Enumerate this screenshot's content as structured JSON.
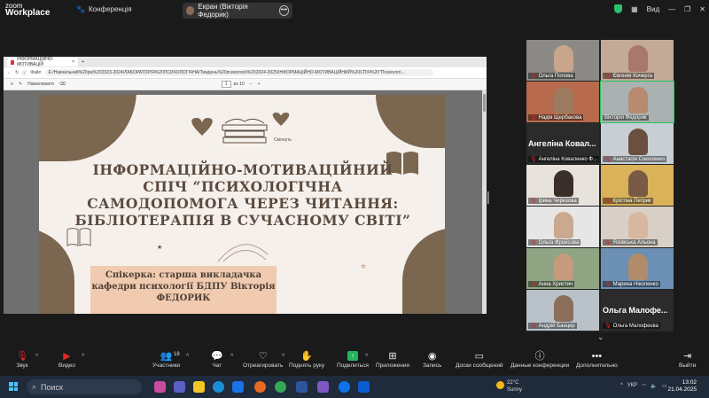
{
  "app": {
    "brand_top": "zoom",
    "brand_bottom": "Workplace",
    "conference_tab": "Конференція"
  },
  "share_pill": {
    "label": "Екран (Вікторія Федорик)"
  },
  "titlebar_right": {
    "view": "Вид"
  },
  "browser": {
    "tab_label": "ІНФОРМАЦІЙНО-МОТИВАЦІЙ",
    "file_label": "Файл",
    "url": "E:/Навчальний%20рік%202023-2024/ЛАБОРАТОРІЯ%20ПСИХОЛОГІЧНА/Тиждень%20психології%202024-2025/ІНФОРМАЦІЙНО-МОТИВАЦІЙНИЙ%20СПІЧ%20\"Психологі...",
    "draw_label": "Намалювати",
    "page_current": "1",
    "page_total": "из 10"
  },
  "slide": {
    "title": "ІНФОРМАЦІЙНО-МОТИВАЦІЙНИЙ СПІЧ “ПСИХОЛОГІЧНА САМОДОПОМОГА ЧЕРЕЗ ЧИТАННЯ: БІБЛІОТЕРАПІЯ В СУЧАСНОМУ СВІТІ”",
    "speaker": "Спікерка: старша викладачка кафедри психології БДПУ Вікторія ФЕДОРИК",
    "book_caption": "Смонуть"
  },
  "participants": [
    {
      "name": "Ольга Попова",
      "mic_muted": true,
      "face": "#c9a58c",
      "bg": "#8c8a86"
    },
    {
      "name": "Євгенія Кочерга",
      "mic_muted": true,
      "face": "#a8786a",
      "bg": "#c3a998"
    },
    {
      "name": "Надія Щербакова",
      "mic_muted": true,
      "face": "#9c7a5e",
      "bg": "#b86a4c"
    },
    {
      "name": "Вікторія Федорик",
      "mic_muted": false,
      "face": "#b88a70",
      "bg": "#a9b2b0",
      "active": true
    },
    {
      "name": "Ангеліна Коваленко Ф...",
      "big": "Ангеліна Ковал...",
      "mic_muted": true
    },
    {
      "name": "Анастасія Соколенко",
      "mic_muted": true,
      "face": "#6b5042",
      "bg": "#c8cfd4"
    },
    {
      "name": "Ірина Черезова",
      "mic_muted": true,
      "face": "#3a2e28",
      "bg": "#e8e2dc"
    },
    {
      "name": "Крістіна Петрик",
      "mic_muted": true,
      "face": "#7a5a44",
      "bg": "#d9b25a"
    },
    {
      "name": "Ольга Фройсова",
      "mic_muted": true,
      "face": "#caa98f",
      "bg": "#e6e6e6"
    },
    {
      "name": "Язовська Альона",
      "mic_muted": true,
      "face": "#d7b7a0",
      "bg": "#d8cfc6"
    },
    {
      "name": "Анна Христич",
      "mic_muted": true,
      "face": "#c69a7d",
      "bg": "#8fa584"
    },
    {
      "name": "Марина Ніколенко",
      "mic_muted": true,
      "face": "#b08c6a",
      "bg": "#6c8fb4"
    },
    {
      "name": "Андрій Банцер",
      "mic_muted": true,
      "face": "#8b6e5c",
      "bg": "#b9c2c9"
    },
    {
      "name": "Ольга Малофеєва",
      "big": "Ольга Малофе...",
      "mic_muted": true
    }
  ],
  "toolbar": {
    "audio": "Звук",
    "video": "Видео",
    "participants": "Участники",
    "participants_count": "18",
    "chat": "Чат",
    "react": "Отреагировать",
    "raise_hand": "Поднять руку",
    "share": "Поделиться",
    "apps": "Приложения",
    "record": "Запись",
    "boards": "Доски сообщений",
    "conf_data": "Данные конференции",
    "more": "Дополнительно",
    "leave": "Выйти"
  },
  "taskbar": {
    "search": "Поиск",
    "temperature": "22°C",
    "weather": "Sunny",
    "lang": "УКР",
    "time": "13:02",
    "date": "21.04.2025"
  }
}
